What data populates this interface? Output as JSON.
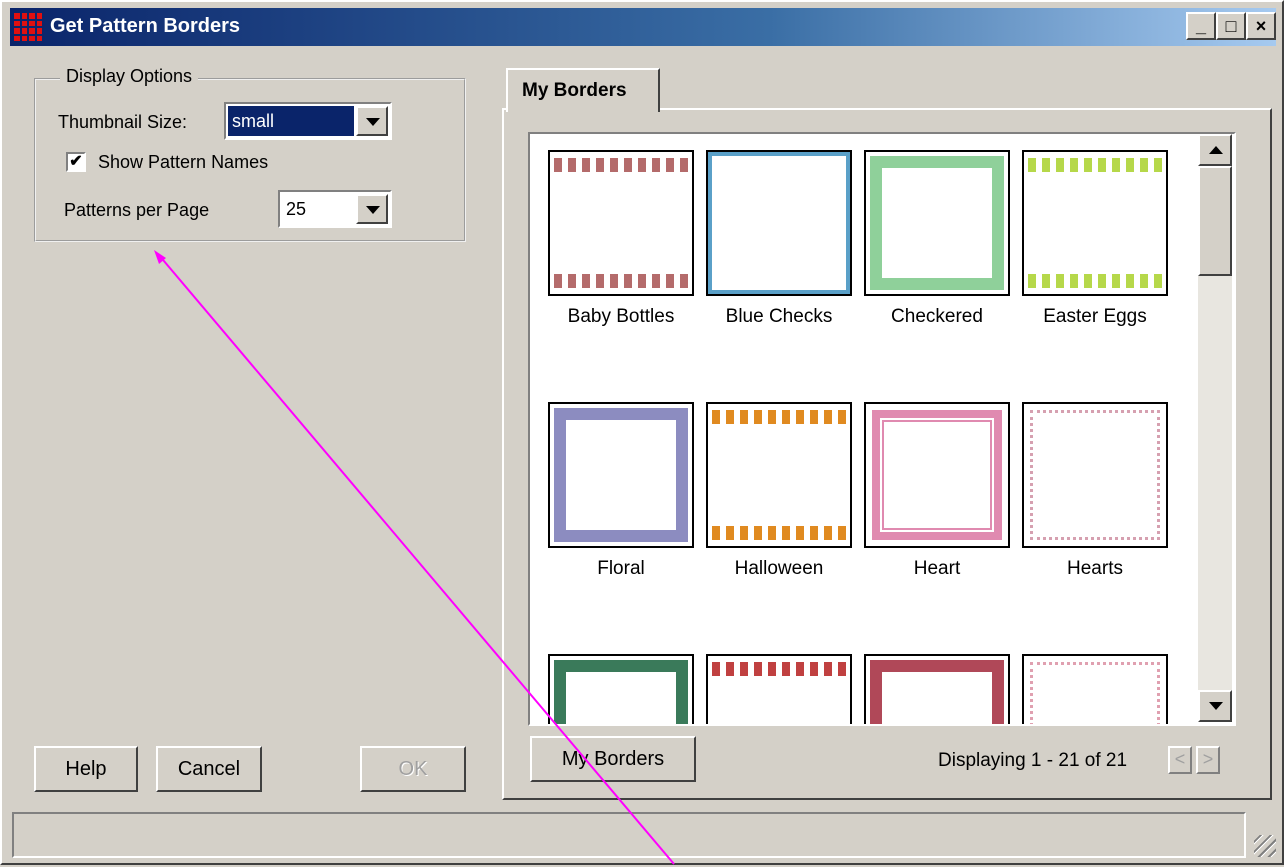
{
  "window": {
    "title": "Get Pattern Borders",
    "controls": {
      "minimize": "_",
      "maximize": "□",
      "close": "×"
    }
  },
  "display_options": {
    "legend": "Display Options",
    "thumbnail_size_label": "Thumbnail Size:",
    "thumbnail_size_value": "small",
    "show_names_label": "Show Pattern Names",
    "show_names_checked": "✔",
    "patterns_per_page_label": "Patterns per Page",
    "patterns_per_page_value": "25"
  },
  "tabs": [
    {
      "label": "My Borders",
      "selected": true
    }
  ],
  "patterns": [
    {
      "name": "Baby Bottles",
      "color": "#b46b6b"
    },
    {
      "name": "Blue Checks",
      "color": "#5aa0c8"
    },
    {
      "name": "Checkered",
      "color": "#8fd09a"
    },
    {
      "name": "Easter Eggs",
      "color": "#b6d84a"
    },
    {
      "name": "Floral",
      "color": "#8c8cc0"
    },
    {
      "name": "Halloween",
      "color": "#e08a20"
    },
    {
      "name": "Heart",
      "color": "#e08ab0"
    },
    {
      "name": "Hearts",
      "color": "#d6a0b0"
    },
    {
      "name": "",
      "color": "#3a7a5a"
    },
    {
      "name": "",
      "color": "#c04040"
    },
    {
      "name": "",
      "color": "#b04858"
    },
    {
      "name": "",
      "color": "#e0a0b0"
    }
  ],
  "buttons": {
    "my_borders": "My Borders",
    "help": "Help",
    "cancel": "Cancel",
    "ok": "OK",
    "prev": "<",
    "next": ">"
  },
  "paging": {
    "text": "Displaying 1 - 21 of 21"
  },
  "colors": {
    "titlebar_start": "#0a246a",
    "annotation_arrow": "#ff00ff"
  }
}
